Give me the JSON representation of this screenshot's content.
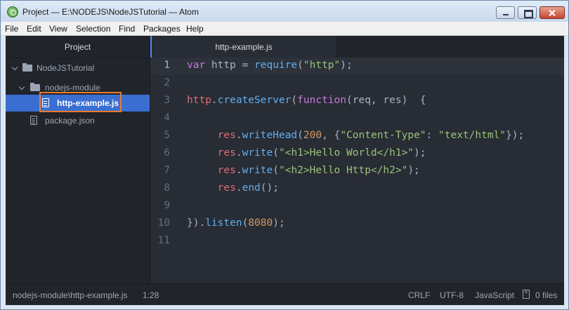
{
  "window": {
    "title": "Project — E:\\NODEJS\\NodeJSTutorial — Atom"
  },
  "menu": [
    "File",
    "Edit",
    "View",
    "Selection",
    "Find",
    "Packages",
    "Help"
  ],
  "tree": {
    "header": "Project",
    "root": "NodeJSTutorial",
    "folder": "nodejs-module",
    "selected_file": "http-example.js",
    "other_file": "package.json"
  },
  "tab": {
    "label": "http-example.js"
  },
  "editor": {
    "line_numbers": [
      "1",
      "2",
      "3",
      "4",
      "5",
      "6",
      "7",
      "8",
      "9",
      "10",
      "11"
    ],
    "lines": [
      [
        [
          "kw",
          "var"
        ],
        [
          "",
          " http = "
        ],
        [
          "fn",
          "require"
        ],
        [
          "",
          "("
        ],
        [
          "st",
          "\"http\""
        ],
        [
          "",
          ");"
        ]
      ],
      [],
      [
        [
          "vr",
          "http"
        ],
        [
          "",
          "."
        ],
        [
          "fn",
          "createServer"
        ],
        [
          "",
          "("
        ],
        [
          "kw",
          "function"
        ],
        [
          "",
          "(req, res)  {"
        ]
      ],
      [],
      [
        [
          "",
          "     "
        ],
        [
          "vr",
          "res"
        ],
        [
          "",
          "."
        ],
        [
          "fn",
          "writeHead"
        ],
        [
          "",
          "("
        ],
        [
          "nm",
          "200"
        ],
        [
          "",
          ", {"
        ],
        [
          "st",
          "\"Content-Type\""
        ],
        [
          "",
          ": "
        ],
        [
          "st",
          "\"text/html\""
        ],
        [
          "",
          "});"
        ]
      ],
      [
        [
          "",
          "     "
        ],
        [
          "vr",
          "res"
        ],
        [
          "",
          "."
        ],
        [
          "fn",
          "write"
        ],
        [
          "",
          "("
        ],
        [
          "st",
          "\"<h1>Hello World</h1>\""
        ],
        [
          "",
          ");"
        ]
      ],
      [
        [
          "",
          "     "
        ],
        [
          "vr",
          "res"
        ],
        [
          "",
          "."
        ],
        [
          "fn",
          "write"
        ],
        [
          "",
          "("
        ],
        [
          "st",
          "\"<h2>Hello Http</h2>\""
        ],
        [
          "",
          ");"
        ]
      ],
      [
        [
          "",
          "     "
        ],
        [
          "vr",
          "res"
        ],
        [
          "",
          "."
        ],
        [
          "fn",
          "end"
        ],
        [
          "",
          "();"
        ]
      ],
      [],
      [
        [
          "",
          "})."
        ],
        [
          "fn",
          "listen"
        ],
        [
          "",
          "("
        ],
        [
          "nm",
          "8080"
        ],
        [
          "",
          ");"
        ]
      ],
      []
    ]
  },
  "status": {
    "path": "nodejs-module\\http-example.js",
    "cursor": "1:28",
    "line_ending": "CRLF",
    "encoding": "UTF-8",
    "grammar": "JavaScript",
    "git": "0 files"
  },
  "colors": {
    "accent": "#568af2",
    "selection": "#3a6fd1",
    "highlight": "#f07a2a"
  }
}
